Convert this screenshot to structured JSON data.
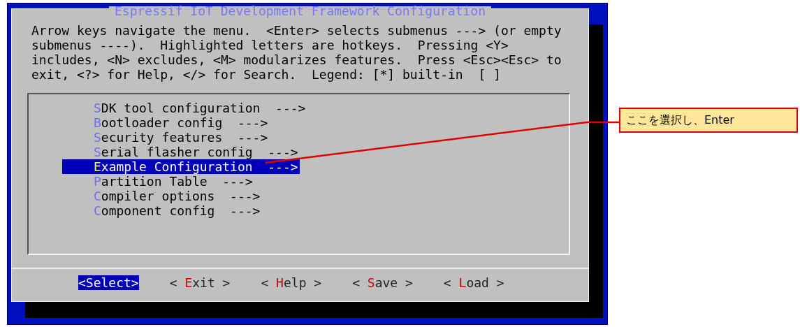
{
  "window": {
    "title": "Espressif IoT Development Framework Configuration"
  },
  "help_text": "Arrow keys navigate the menu.  <Enter> selects submenus ---> (or empty submenus ----).  Highlighted letters are hotkeys.  Pressing <Y> includes, <N> excludes, <M> modularizes features.  Press <Esc><Esc> to exit, <?> for Help, </> for Search.  Legend: [*] built-in  [ ]",
  "menu_items": [
    {
      "label": "SDK tool configuration  --->",
      "selected": false
    },
    {
      "label": "Bootloader config  --->",
      "selected": false
    },
    {
      "label": "Security features  --->",
      "selected": false
    },
    {
      "label": "Serial flasher config  --->",
      "selected": false
    },
    {
      "label": "Example Configuration  --->",
      "selected": true
    },
    {
      "label": "Partition Table  --->",
      "selected": false
    },
    {
      "label": "Compiler options  --->",
      "selected": false
    },
    {
      "label": "Component config  --->",
      "selected": false
    }
  ],
  "buttons": [
    {
      "label": "<Select>",
      "selected": true
    },
    {
      "label": "< Exit >",
      "selected": false
    },
    {
      "label": "< Help >",
      "selected": false
    },
    {
      "label": "< Save >",
      "selected": false
    },
    {
      "label": "< Load >",
      "selected": false
    }
  ],
  "callout": {
    "text": "ここを選択し、Enter"
  }
}
